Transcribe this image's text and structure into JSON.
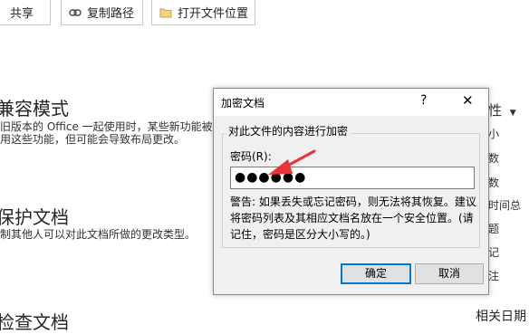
{
  "toolbar": {
    "share_label": "共享",
    "copy_path_label": "复制路径",
    "open_location_label": "打开文件位置"
  },
  "backstage": {
    "compat_title": "兼容模式",
    "compat_line1": "旧版本的 Office 一起使用时，某些新功能被",
    "compat_line2": "用这些功能，但可能会导致布局更改。",
    "protect_title": "保护文档",
    "protect_line1": "制其他人可以对此文档所做的更改类型。",
    "inspect_title": "检查文档",
    "right_property": "性",
    "right_chars": [
      "小",
      "数",
      "数",
      "时间总",
      "题",
      "记",
      "注"
    ],
    "related_dates": "相关日期"
  },
  "dialog": {
    "title": "加密文档",
    "help": "?",
    "close": "✕",
    "group_label": "对此文件的内容进行加密",
    "password_label": "密码(R):",
    "password_value": "●●●●●●",
    "warning": "警告: 如果丢失或忘记密码，则无法将其恢复。建议将密码列表及其相应文档名放在一个安全位置。(请记住，密码是区分大小写的。)",
    "ok_label": "确定",
    "cancel_label": "取消"
  },
  "colors": {
    "accent": "#0078d7",
    "annotation_arrow": "#e8333a"
  }
}
